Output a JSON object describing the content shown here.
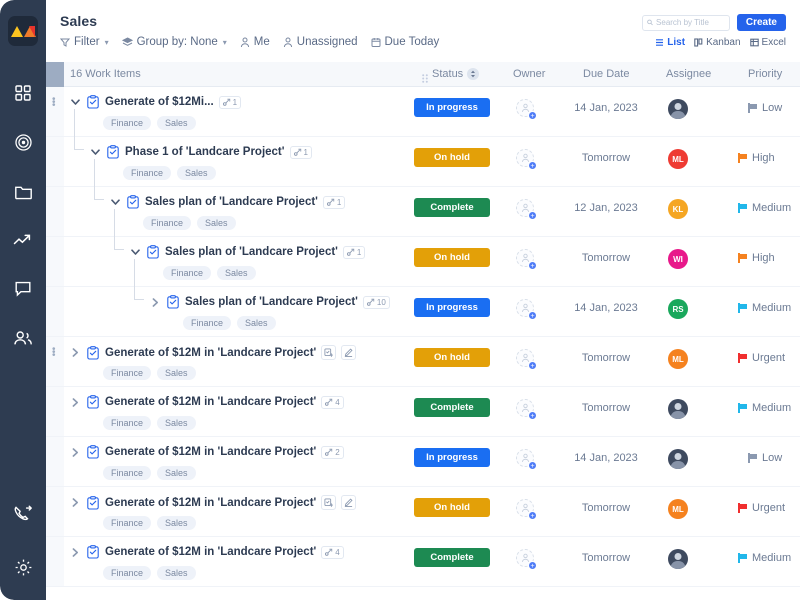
{
  "brand": {
    "logo_name": "app-logo",
    "sidebar_bg": "#2e3c51"
  },
  "sidebar": {
    "items": [
      {
        "name": "dashboard",
        "icon": "grid-icon"
      },
      {
        "name": "goals",
        "icon": "target-icon"
      },
      {
        "name": "files",
        "icon": "folder-icon"
      },
      {
        "name": "analytics",
        "icon": "trending-up-icon"
      },
      {
        "name": "messages",
        "icon": "chat-bubble-icon"
      },
      {
        "name": "team",
        "icon": "people-icon"
      }
    ],
    "bottom_items": [
      {
        "name": "calls",
        "icon": "phone-forward-icon"
      },
      {
        "name": "settings",
        "icon": "gear-icon"
      }
    ]
  },
  "header": {
    "title": "Sales",
    "toolbar": [
      {
        "label": "Filter",
        "icon": "funnel-icon",
        "chevron": true
      },
      {
        "label": "Group by: None",
        "icon": "layers-icon",
        "chevron": true
      },
      {
        "label": "Me",
        "icon": "person-icon",
        "chevron": false
      },
      {
        "label": "Unassigned",
        "icon": "person-outline-icon",
        "chevron": false
      },
      {
        "label": "Due Today",
        "icon": "calendar-icon",
        "chevron": false
      }
    ],
    "search": {
      "placeholder": "Search by Title",
      "value": "",
      "icon": "search-icon"
    },
    "create_label": "Create",
    "views": [
      {
        "label": "List",
        "icon": "list-icon",
        "active": true
      },
      {
        "label": "Kanban",
        "icon": "kanban-icon",
        "active": false
      },
      {
        "label": "Excel",
        "icon": "excel-icon",
        "active": false
      }
    ]
  },
  "table": {
    "count_label": "16 Work Items",
    "columns": [
      {
        "key": "status",
        "label": "Status",
        "sortable": true
      },
      {
        "key": "owner",
        "label": "Owner",
        "sortable": false
      },
      {
        "key": "due_date",
        "label": "Due Date",
        "sortable": false
      },
      {
        "key": "assignee",
        "label": "Assignee",
        "sortable": false
      },
      {
        "key": "priority",
        "label": "Priority",
        "sortable": false
      }
    ],
    "add_column_label": "+",
    "status_colors": {
      "In progress": "#1a6ef2",
      "On hold": "#e3a008",
      "Complete": "#1d8a52"
    },
    "priority_colors": {
      "Low": "#8b99b0",
      "Medium": "#21b7ea",
      "High": "#f58220",
      "Urgent": "#f02f2f"
    },
    "rows": [
      {
        "title": "Generate of $12Mi...",
        "depth": 0,
        "expanded": true,
        "count": "1",
        "count_icon": "subtask-link-icon",
        "actions": [],
        "tags": [
          "Finance",
          "Sales"
        ],
        "status": "In progress",
        "owner": "unassigned",
        "due_date": "14 Jan, 2023",
        "assignee": {
          "type": "photo",
          "initials": ""
        },
        "priority": "Low",
        "kebab": true
      },
      {
        "title": "Phase 1 of 'Landcare Project'",
        "depth": 1,
        "expanded": true,
        "count": "1",
        "count_icon": "subtask-link-icon",
        "actions": [],
        "tags": [
          "Finance",
          "Sales"
        ],
        "status": "On hold",
        "owner": "unassigned",
        "due_date": "Tomorrow",
        "assignee": {
          "type": "initials",
          "initials": "ML",
          "color": "#ee3b33"
        },
        "priority": "High",
        "kebab": false
      },
      {
        "title": "Sales plan of 'Landcare Project'",
        "depth": 2,
        "expanded": true,
        "count": "1",
        "count_icon": "subtask-link-icon",
        "actions": [],
        "tags": [
          "Finance",
          "Sales"
        ],
        "status": "Complete",
        "owner": "unassigned",
        "due_date": "12 Jan, 2023",
        "assignee": {
          "type": "initials",
          "initials": "KL",
          "color": "#f5a623"
        },
        "priority": "Medium",
        "kebab": false
      },
      {
        "title": "Sales plan of 'Landcare Project'",
        "depth": 3,
        "expanded": true,
        "count": "1",
        "count_icon": "subtask-link-icon",
        "actions": [],
        "tags": [
          "Finance",
          "Sales"
        ],
        "status": "On hold",
        "owner": "unassigned",
        "due_date": "Tomorrow",
        "assignee": {
          "type": "initials",
          "initials": "WI",
          "color": "#e8188a"
        },
        "priority": "High",
        "kebab": false
      },
      {
        "title": "Sales plan of 'Landcare Project'",
        "depth": 4,
        "expanded": false,
        "count": "10",
        "count_icon": "subtask-link-icon",
        "actions": [],
        "tags": [
          "Finance",
          "Sales"
        ],
        "status": "In progress",
        "owner": "unassigned",
        "due_date": "14 Jan, 2023",
        "assignee": {
          "type": "initials",
          "initials": "RS",
          "color": "#1aa85c"
        },
        "priority": "Medium",
        "kebab": false
      },
      {
        "title": "Generate of $12M in 'Landcare Project'",
        "depth": 0,
        "expanded": false,
        "count": "",
        "count_icon": "",
        "actions": [
          "add-subtask-icon",
          "edit-pencil-icon"
        ],
        "tags": [
          "Finance",
          "Sales"
        ],
        "status": "On hold",
        "owner": "unassigned",
        "due_date": "Tomorrow",
        "assignee": {
          "type": "initials",
          "initials": "ML",
          "color": "#f5821f"
        },
        "priority": "Urgent",
        "kebab": true
      },
      {
        "title": "Generate of $12M in 'Landcare Project'",
        "depth": 0,
        "expanded": false,
        "count": "4",
        "count_icon": "subtask-link-icon",
        "actions": [],
        "tags": [
          "Finance",
          "Sales"
        ],
        "status": "Complete",
        "owner": "unassigned",
        "due_date": "Tomorrow",
        "assignee": {
          "type": "photo",
          "initials": ""
        },
        "priority": "Medium",
        "kebab": false
      },
      {
        "title": "Generate of $12M in 'Landcare Project'",
        "depth": 0,
        "expanded": false,
        "count": "2",
        "count_icon": "subtask-link-icon",
        "actions": [],
        "tags": [
          "Finance",
          "Sales"
        ],
        "status": "In progress",
        "owner": "unassigned",
        "due_date": "14 Jan, 2023",
        "assignee": {
          "type": "photo",
          "initials": ""
        },
        "priority": "Low",
        "kebab": false
      },
      {
        "title": "Generate of $12M in 'Landcare Project'",
        "depth": 0,
        "expanded": false,
        "count": "",
        "count_icon": "",
        "actions": [
          "add-subtask-icon",
          "edit-pencil-icon"
        ],
        "tags": [
          "Finance",
          "Sales"
        ],
        "status": "On hold",
        "owner": "unassigned",
        "due_date": "Tomorrow",
        "assignee": {
          "type": "initials",
          "initials": "ML",
          "color": "#f5821f"
        },
        "priority": "Urgent",
        "kebab": false
      },
      {
        "title": "Generate of $12M in 'Landcare Project'",
        "depth": 0,
        "expanded": false,
        "count": "4",
        "count_icon": "subtask-link-icon",
        "actions": [],
        "tags": [
          "Finance",
          "Sales"
        ],
        "status": "Complete",
        "owner": "unassigned",
        "due_date": "Tomorrow",
        "assignee": {
          "type": "photo",
          "initials": ""
        },
        "priority": "Medium",
        "kebab": false
      }
    ]
  }
}
